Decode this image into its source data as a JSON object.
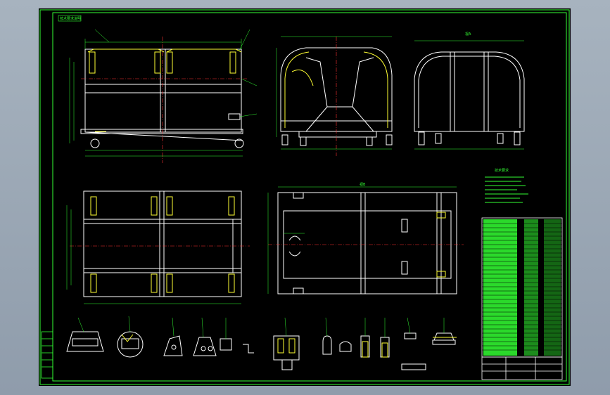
{
  "drawing": {
    "stamp_label": "技术要求说明",
    "view_label_top_right": "视A",
    "view_label_bottom_mid": "视B",
    "bottom_view_label": "视",
    "notes_title": "技术要求"
  },
  "colors": {
    "background": "#000000",
    "border": "#33ff33",
    "outline": "#ffffff",
    "hidden": "#ffff33",
    "dimension": "#33ff33",
    "center": "#ff3333",
    "table_fill": "#33ff33"
  },
  "icons": {
    "cad_sheet": "drawing-sheet-icon"
  }
}
